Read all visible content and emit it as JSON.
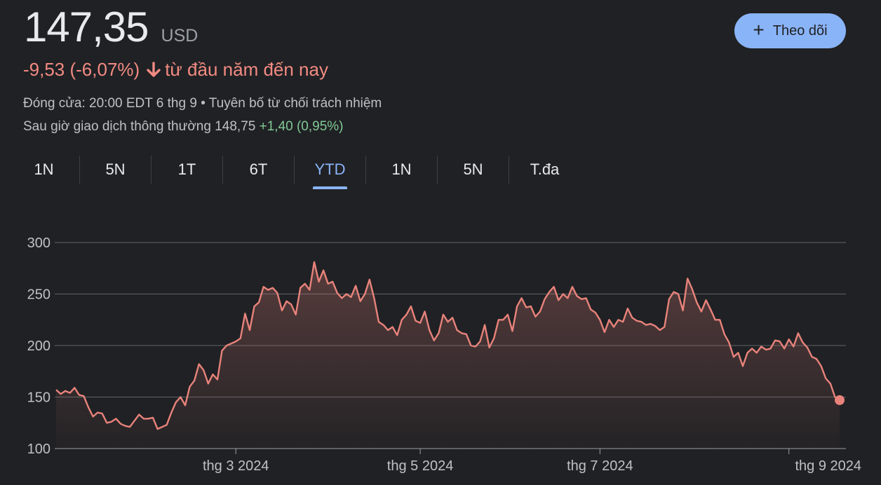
{
  "header": {
    "price": "147,35",
    "currency": "USD",
    "change": "-9,53 (-6,07%)",
    "change_suffix": "từ đầu năm đến nay",
    "close_info": "Đóng cửa: 20:00 EDT 6 thg 9 • Tuyên bố từ chối trách nhiệm",
    "after_hours_label": "Sau giờ giao dịch thông thường 148,75",
    "after_hours_change": "+1,40 (0,95%)",
    "follow_label": "Theo dõi"
  },
  "colors": {
    "negative": "#f28b82",
    "positive": "#81c995",
    "accent": "#8ab4f8",
    "background": "#202124",
    "line": "#e8837b"
  },
  "tabs": [
    {
      "label": "1N",
      "active": false
    },
    {
      "label": "5N",
      "active": false
    },
    {
      "label": "1T",
      "active": false
    },
    {
      "label": "6T",
      "active": false
    },
    {
      "label": "YTD",
      "active": true
    },
    {
      "label": "1N",
      "active": false
    },
    {
      "label": "5N",
      "active": false
    },
    {
      "label": "T.đa",
      "active": false
    }
  ],
  "chart_data": {
    "type": "area",
    "title": "",
    "xlabel": "",
    "ylabel": "",
    "ylim": [
      100,
      300
    ],
    "y_ticks": [
      300,
      250,
      200,
      150,
      100
    ],
    "x_ticks": [
      "thg 3 2024",
      "thg 5 2024",
      "thg 7 2024",
      "thg 9 2024"
    ],
    "x_tick_indices": [
      39,
      79,
      118,
      159
    ],
    "grid": true,
    "series": [
      {
        "values": [
          157,
          153,
          156,
          154,
          159,
          152,
          151,
          140,
          131,
          135,
          134,
          125,
          126,
          129,
          124,
          122,
          121,
          127,
          133,
          129,
          129,
          130,
          119,
          121,
          123,
          135,
          145,
          150,
          142,
          160,
          166,
          182,
          176,
          163,
          172,
          167,
          195,
          200,
          202,
          204,
          207,
          231,
          215,
          238,
          242,
          257,
          254,
          256,
          251,
          234,
          243,
          240,
          230,
          256,
          260,
          254,
          281,
          262,
          273,
          260,
          262,
          251,
          246,
          250,
          247,
          258,
          243,
          250,
          264,
          246,
          223,
          220,
          215,
          218,
          210,
          225,
          230,
          238,
          224,
          222,
          233,
          215,
          205,
          212,
          230,
          223,
          227,
          215,
          212,
          211,
          200,
          199,
          204,
          220,
          198,
          207,
          225,
          225,
          230,
          214,
          238,
          246,
          237,
          238,
          228,
          233,
          245,
          252,
          257,
          244,
          250,
          246,
          257,
          248,
          245,
          246,
          235,
          232,
          225,
          213,
          225,
          218,
          225,
          223,
          236,
          227,
          224,
          223,
          220,
          221,
          219,
          215,
          218,
          245,
          252,
          250,
          234,
          265,
          255,
          242,
          233,
          244,
          235,
          225,
          225,
          211,
          203,
          189,
          193,
          180,
          193,
          197,
          193,
          199,
          196,
          197,
          205,
          204,
          197,
          206,
          199,
          212,
          203,
          198,
          189,
          187,
          180,
          168,
          163,
          150,
          147
        ]
      }
    ]
  }
}
